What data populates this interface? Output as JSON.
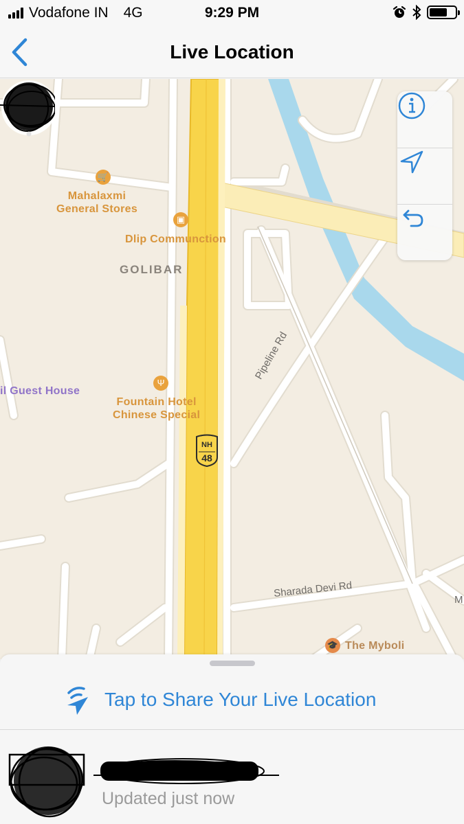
{
  "status_bar": {
    "carrier": "Vodafone IN",
    "network": "4G",
    "time": "9:29 PM",
    "battery_level": 0.7,
    "icons": [
      "signal-icon",
      "alarm-icon",
      "bluetooth-icon",
      "battery-icon"
    ]
  },
  "nav": {
    "title": "Live Location",
    "back_icon": "chevron-left-icon"
  },
  "map": {
    "labels": {
      "mahalaxmi": [
        "Mahalaxmi",
        "General Stores"
      ],
      "dlip": "Dlip Communction",
      "golibar": "GOLIBAR",
      "guest_house": "il Guest House",
      "fountain": [
        "Fountain Hotel",
        "Chinese Special"
      ],
      "pipeline": "Pipeline Rd",
      "sharada": "Sharada Devi Rd",
      "myboli": "The Myboli",
      "edge": "M"
    },
    "highway_shield": {
      "line1": "NH",
      "line2": "48"
    },
    "controls": [
      "info-icon",
      "location-arrow-icon",
      "return-icon"
    ]
  },
  "sheet": {
    "share_label": "Tap to Share Your Live Location",
    "share_icon": "live-location-share-icon",
    "contact_status": "Updated just now"
  },
  "colors": {
    "accent": "#2f86d6",
    "highway": "#f8d44a",
    "water": "#a9d8ec",
    "land": "#f3ede2",
    "road": "#ffffff",
    "poi_orange": "#d8953c",
    "poi_purple": "#9074c8"
  }
}
